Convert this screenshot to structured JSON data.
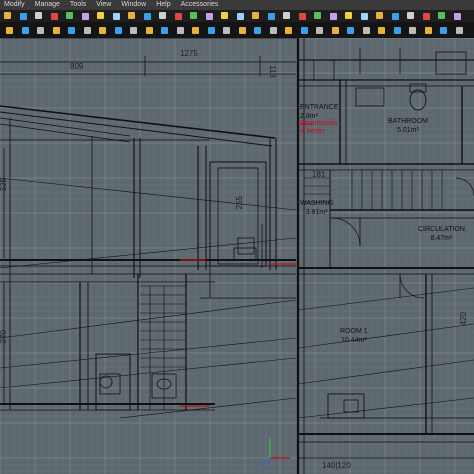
{
  "menubar": {
    "items": [
      "Modify",
      "Manage",
      "Tools",
      "View",
      "Window",
      "Help",
      "Accessories"
    ]
  },
  "colors": {
    "canvas_bg": "#5e6870",
    "grid_minor": "#6a747b",
    "grid_major": "#7d868c",
    "line": "#111111",
    "selected": "#c0101a",
    "accent": "#e8b23a"
  },
  "dimensions": {
    "d_809": "809",
    "d_1275": "1275",
    "d_113": "113",
    "d_325": "325",
    "d_255": "255",
    "d_270": "270",
    "d_181": "181",
    "d_420": "420",
    "d_140120": "140|120"
  },
  "rooms": {
    "entrance": {
      "name": "ENTRANCE",
      "area": "2.8m²"
    },
    "bathroom": {
      "name": "BATHROOM",
      "area": "5.01m²"
    },
    "washing": {
      "name": "WASHING",
      "area": "3.81m²"
    },
    "circulation": {
      "name": "CIRCULATION",
      "area": "8.47m²"
    },
    "room1": {
      "name": "ROOM 1",
      "area": "10.44m²"
    }
  },
  "annotation": {
    "line1": "Smartstudio",
    "line2": "is better"
  },
  "toolbar_icons": [
    "select-icon",
    "link-icon",
    "cursor-icon",
    "snap-icon",
    "grid-icon",
    "layer-icon",
    "pen-icon",
    "eraser-icon",
    "zoom-icon",
    "pan-icon",
    "measure-icon",
    "text-icon",
    "dim-icon",
    "wall-icon",
    "door-icon",
    "window-icon",
    "stair-icon",
    "roof-icon",
    "slab-icon",
    "column-icon",
    "beam-icon",
    "object-icon",
    "lamp-icon",
    "zone-icon",
    "label-icon",
    "section-icon",
    "elevation-icon",
    "camera-icon",
    "render-icon",
    "settings-icon"
  ]
}
